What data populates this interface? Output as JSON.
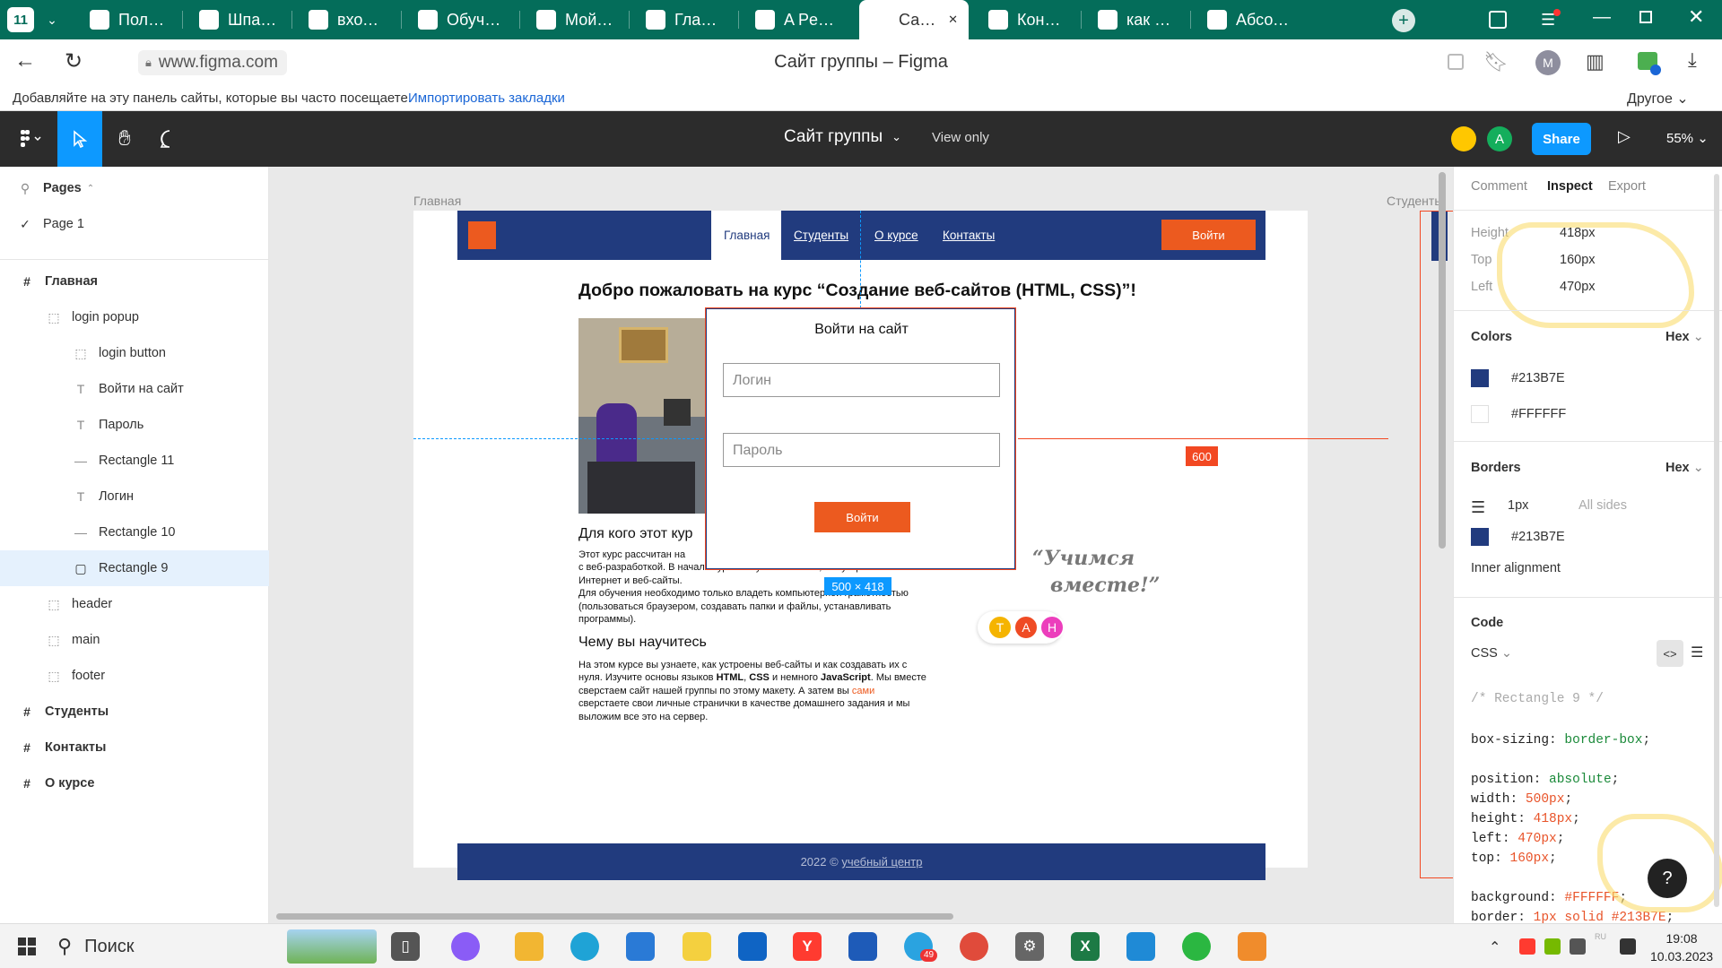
{
  "browser": {
    "workspace_badge": "11",
    "tabs": [
      {
        "title": "Полное в",
        "active": false,
        "icon": "atom-icon"
      },
      {
        "title": "Шпаргал",
        "active": false,
        "icon": "tb-icon"
      },
      {
        "title": "вход – Сл",
        "active": false,
        "icon": "atom-icon"
      },
      {
        "title": "Обучени",
        "active": false,
        "icon": "doc-icon"
      },
      {
        "title": "Мой перв",
        "active": false,
        "icon": "doc-icon"
      },
      {
        "title": "Главная",
        "active": false,
        "icon": "page-icon"
      },
      {
        "title": "A Pen by",
        "active": false,
        "icon": "codepen-icon"
      },
      {
        "title": "Сайт гр",
        "active": true,
        "icon": "figma-icon"
      },
      {
        "title": "Консульт",
        "active": false,
        "icon": "w-icon"
      },
      {
        "title": "как для а",
        "active": false,
        "icon": "yandex-icon"
      },
      {
        "title": "Абсолют",
        "active": false,
        "icon": "cloud-icon"
      }
    ],
    "url": "www.figma.com",
    "page_title": "Сайт группы – Figma",
    "profile_letter": "M",
    "bookmarks_hint": "Добавляйте на эту панель сайты, которые вы часто посещаете.",
    "bookmarks_import": "Импортировать закладки",
    "bookmarks_other": "Другое"
  },
  "figma": {
    "file_name": "Сайт группы",
    "view_mode": "View only",
    "share_label": "Share",
    "zoom": "55%",
    "avatar_letter": "A"
  },
  "layers": {
    "pages_label": "Pages",
    "pages": [
      {
        "name": "Page 1"
      }
    ],
    "items": [
      {
        "name": "Главная",
        "icon": "#",
        "indent": 0,
        "selected": false,
        "bold": true
      },
      {
        "name": "login popup",
        "icon": "frame",
        "indent": 1,
        "selected": false,
        "bold": false
      },
      {
        "name": "login button",
        "icon": "frame",
        "indent": 2,
        "selected": false,
        "bold": false
      },
      {
        "name": "Войти на сайт",
        "icon": "T",
        "indent": 2,
        "selected": false,
        "bold": false
      },
      {
        "name": "Пароль",
        "icon": "T",
        "indent": 2,
        "selected": false,
        "bold": false
      },
      {
        "name": "Rectangle 11",
        "icon": "line",
        "indent": 2,
        "selected": false,
        "bold": false
      },
      {
        "name": "Логин",
        "icon": "T",
        "indent": 2,
        "selected": false,
        "bold": false
      },
      {
        "name": "Rectangle 10",
        "icon": "line",
        "indent": 2,
        "selected": false,
        "bold": false
      },
      {
        "name": "Rectangle 9",
        "icon": "rect",
        "indent": 2,
        "selected": true,
        "bold": false
      },
      {
        "name": "header",
        "icon": "frame",
        "indent": 1,
        "selected": false,
        "bold": false
      },
      {
        "name": "main",
        "icon": "frame",
        "indent": 1,
        "selected": false,
        "bold": false
      },
      {
        "name": "footer",
        "icon": "frame",
        "indent": 1,
        "selected": false,
        "bold": false
      },
      {
        "name": "Студенты",
        "icon": "#",
        "indent": 0,
        "selected": false,
        "bold": true
      },
      {
        "name": "Контакты",
        "icon": "#",
        "indent": 0,
        "selected": false,
        "bold": true
      },
      {
        "name": "О курсе",
        "icon": "#",
        "indent": 0,
        "selected": false,
        "bold": true
      }
    ]
  },
  "canvas": {
    "frame_label": "Главная",
    "frame2_label": "Студенты",
    "nav": [
      "Главная",
      "Студенты",
      "О курсе",
      "Контакты"
    ],
    "login_button": "Войти",
    "heading": "Добро пожаловать на курс “Создание веб-сайтов (HTML, CSS)”!",
    "section1_title": "Для кого этот кур",
    "section1_line1": "Этот курс рассчитан на",
    "section1_line2": "с веб-разработкой. В на",
    "section1_line2b": "чале курса вы узнаете о том, как устроен",
    "section1_line3": "Интернет и веб-сайты.",
    "section1_line4": "Для обучения необходимо только владеть компьютерной грамотностью",
    "section1_line5": "(пользоваться браузером, создавать папки и файлы, устанавливать",
    "section1_line6": "программы).",
    "section2_title": "Чему вы научитесь",
    "section2_p1": "На этом курсе вы узнаете, как устроены веб-сайты и как создавать их с",
    "section2_p2a": "нуля. Изучите основы языков ",
    "section2_html": "HTML",
    "section2_comma": ", ",
    "section2_css": "CSS",
    "section2_p2b": " и немного ",
    "section2_js": "JavaScript",
    "section2_p2c": ". Мы вместе",
    "section2_p3a": "сверстаем сайт нашей группы по этому макету. А затем вы ",
    "section2_sami": "сами",
    "section2_p4": "сверстаете свои личные странички в качестве домашнего задания и мы",
    "section2_p5": "выложим все это на сервер.",
    "quote_line1": "“Учимся",
    "quote_line2": "вместе!”",
    "avatars": [
      {
        "letter": "T",
        "color": "#f5b400"
      },
      {
        "letter": "A",
        "color": "#ef4b24"
      },
      {
        "letter": "H",
        "color": "#ec3ebc"
      }
    ],
    "footer_year": "2022 © ",
    "footer_link": "учебный центр",
    "popup_title": "Войти на сайт",
    "popup_login_ph": "Логин",
    "popup_pass_ph": "Пароль",
    "popup_button": "Войти",
    "size_badge": "500 × 418",
    "distance_badge": "600"
  },
  "inspect": {
    "tabs": [
      "Comment",
      "Inspect",
      "Export"
    ],
    "active_tab": "Inspect",
    "props": [
      {
        "label": "Height",
        "value": "418px"
      },
      {
        "label": "Top",
        "value": "160px"
      },
      {
        "label": "Left",
        "value": "470px"
      }
    ],
    "colors_title": "Colors",
    "hex_label": "Hex",
    "colors": [
      "#213B7E",
      "#FFFFFF"
    ],
    "borders_title": "Borders",
    "border_width": "1px",
    "border_sides": "All sides",
    "border_color": "#213B7E",
    "inner_alignment": "Inner alignment",
    "code_title": "Code",
    "code_lang": "CSS",
    "code_comment": "/* Rectangle 9 */",
    "code_lines": [
      {
        "prop": "box-sizing",
        "val": "border-box",
        "gap_before": false
      },
      {
        "prop": "position",
        "val": "absolute",
        "gap_before": true
      },
      {
        "prop": "width",
        "val": "500px",
        "gap_before": false
      },
      {
        "prop": "height",
        "val": "418px",
        "gap_before": false
      },
      {
        "prop": "left",
        "val": "470px",
        "gap_before": false
      },
      {
        "prop": "top",
        "val": "160px",
        "gap_before": false
      },
      {
        "prop": "background",
        "val": "#FFFFFF",
        "gap_before": true
      },
      {
        "prop": "border",
        "val": "1px solid #213B7E",
        "gap_before": false
      }
    ],
    "help": "?"
  },
  "taskbar": {
    "search_label": "Поиск",
    "time": "19:08",
    "date": "10.03.2023",
    "lang": "RU",
    "telegram_badge": "49"
  },
  "colors": {
    "brand_blue": "#213B7E",
    "brand_orange": "#EC5A1F",
    "tab_strip": "#046D5A",
    "figma_blue": "#0D99FF"
  }
}
